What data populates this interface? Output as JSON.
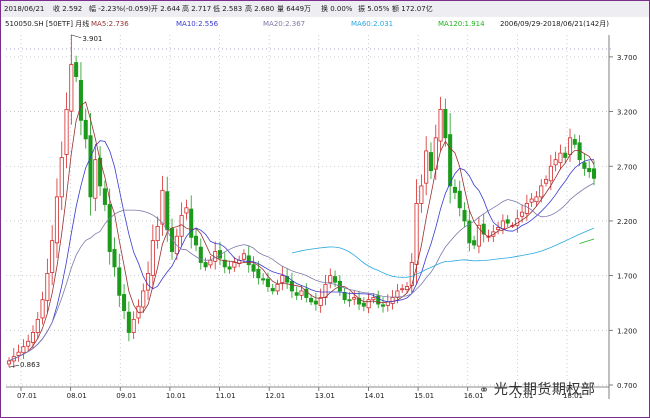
{
  "info_bar": {
    "date": "2018/06/21",
    "close": "收 2.592",
    "change": "幅 -2.23%(-0.059)",
    "open": "开 2.644",
    "high": "高 2.717",
    "low": "低 2.583",
    "high2": "高 2.680",
    "volume": "量 6449万",
    "turnover_rate": "换 0.00%",
    "amplitude": "振 5.05%",
    "amount": "额 172.07亿"
  },
  "range_label": "2006/09/29-2018/06/21(142月)",
  "watermark": "光大期货期权部",
  "colors": {
    "up": "#d42a2a",
    "down": "#1c9a1c",
    "ma5": "#9a3030",
    "ma10": "#3a3ad0",
    "ma20": "#7a7aaa",
    "ma60": "#28a8e0",
    "ma120": "#22b222",
    "axis_text": "#202020",
    "grid": "#c0c0c8"
  },
  "chart_data": {
    "type": "candlestick",
    "title": "510050.SH [50ETF] 月线",
    "legend": [
      {
        "label": "MA5:2.736",
        "color": "#9a3030"
      },
      {
        "label": "MA10:2.556",
        "color": "#3a3ad0"
      },
      {
        "label": "MA20:2.367",
        "color": "#7a7aaa"
      },
      {
        "label": "MA60:2.031",
        "color": "#28a8e0"
      },
      {
        "label": "MA120:1.914",
        "color": "#22b222"
      }
    ],
    "x_tick_labels": [
      "07.01",
      "08.01",
      "09.01",
      "10.01",
      "11.01",
      "12.01",
      "13.01",
      "14.01",
      "15.01",
      "16.01",
      "17.01",
      "18.01"
    ],
    "y_tick_labels": [
      "0.700",
      "1.200",
      "1.700",
      "2.200",
      "2.700",
      "3.200",
      "3.700"
    ],
    "y_range": [
      0.7,
      3.9
    ],
    "annotations": [
      {
        "text": "3.901",
        "value": 3.901
      },
      {
        "text": "0.863",
        "value": 0.863
      }
    ],
    "grid": true,
    "closes": [
      0.92,
      0.96,
      1.0,
      1.05,
      1.1,
      1.18,
      1.3,
      1.48,
      1.72,
      2.02,
      2.42,
      2.78,
      3.22,
      3.63,
      3.52,
      3.12,
      2.95,
      2.42,
      2.76,
      2.52,
      2.35,
      1.92,
      1.78,
      1.52,
      1.38,
      1.18,
      1.3,
      1.42,
      1.56,
      1.72,
      2.02,
      2.15,
      2.48,
      2.12,
      1.92,
      2.06,
      2.25,
      2.32,
      2.05,
      1.98,
      1.82,
      1.78,
      1.84,
      1.92,
      1.86,
      1.78,
      1.76,
      1.82,
      1.84,
      1.9,
      1.8,
      1.74,
      1.68,
      1.66,
      1.6,
      1.56,
      1.62,
      1.7,
      1.64,
      1.56,
      1.52,
      1.56,
      1.5,
      1.46,
      1.44,
      1.5,
      1.62,
      1.7,
      1.64,
      1.56,
      1.48,
      1.47,
      1.5,
      1.44,
      1.42,
      1.48,
      1.5,
      1.44,
      1.42,
      1.46,
      1.5,
      1.56,
      1.58,
      1.6,
      1.82,
      2.36,
      2.52,
      2.84,
      2.66,
      2.96,
      3.22,
      2.96,
      2.52,
      2.46,
      2.32,
      2.2,
      2.0,
      1.98,
      2.16,
      2.08,
      2.06,
      2.1,
      2.14,
      2.2,
      2.18,
      2.16,
      2.22,
      2.28,
      2.36,
      2.4,
      2.42,
      2.52,
      2.58,
      2.7,
      2.76,
      2.82,
      2.78,
      2.96,
      2.9,
      2.76,
      2.68,
      2.65,
      2.59
    ]
  }
}
